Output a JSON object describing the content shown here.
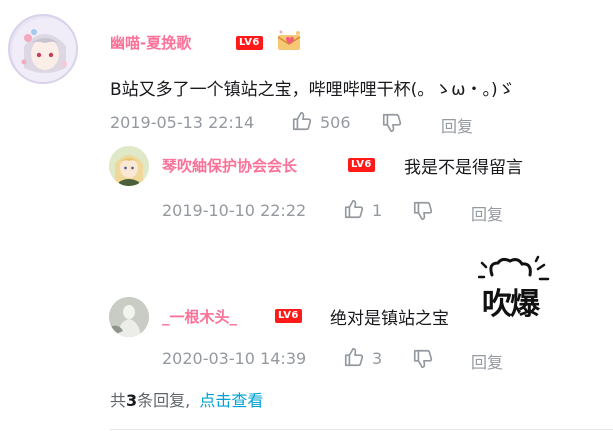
{
  "comments": [
    {
      "username": "幽喵-夏挽歌",
      "level": "LV6",
      "text": "B站又多了一个镇站之宝，哔哩哔哩干杯(。ゝω・。)ゞ",
      "time": "2019-05-13 22:14",
      "likes": "506",
      "reply_label": "回复"
    }
  ],
  "replies": [
    {
      "username": "琴吹紬保护协会会长",
      "level": "LV6",
      "text": "我是不是得留言",
      "time": "2019-10-10 22:22",
      "likes": "1",
      "reply_label": "回复"
    },
    {
      "username": "_一根木头_",
      "level": "LV6",
      "text": "绝对是镇站之宝",
      "sticker_text": "吹爆",
      "time": "2020-03-10 14:39",
      "likes": "3",
      "reply_label": "回复"
    }
  ],
  "footer": {
    "prefix": "共",
    "count": "3",
    "suffix": "条回复,",
    "link": "点击查看"
  },
  "colors": {
    "username": "#fb7299",
    "level_badge": "#ff1a1a",
    "meta": "#9499a0",
    "link": "#00a1d6"
  }
}
